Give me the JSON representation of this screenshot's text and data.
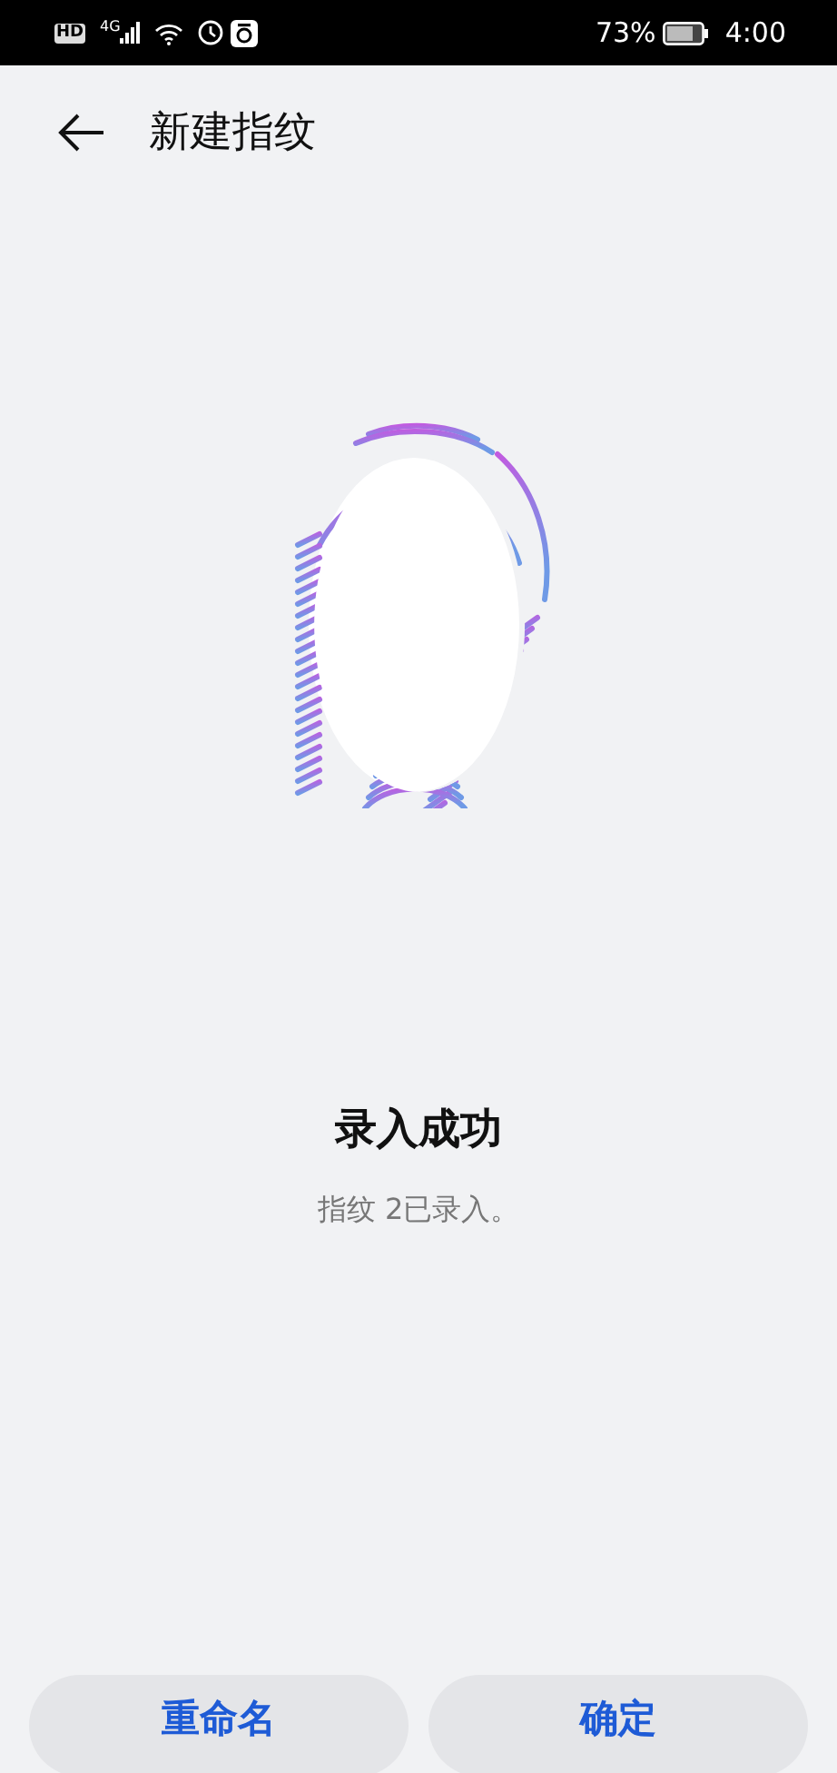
{
  "status_bar": {
    "hd": "HD",
    "network": "4G",
    "battery_percent": "73%",
    "time": "4:00"
  },
  "header": {
    "title": "新建指纹"
  },
  "result": {
    "title": "录入成功",
    "message": "指纹 2已录入。"
  },
  "buttons": [
    {
      "label": "重命名"
    },
    {
      "label": "确定"
    }
  ]
}
